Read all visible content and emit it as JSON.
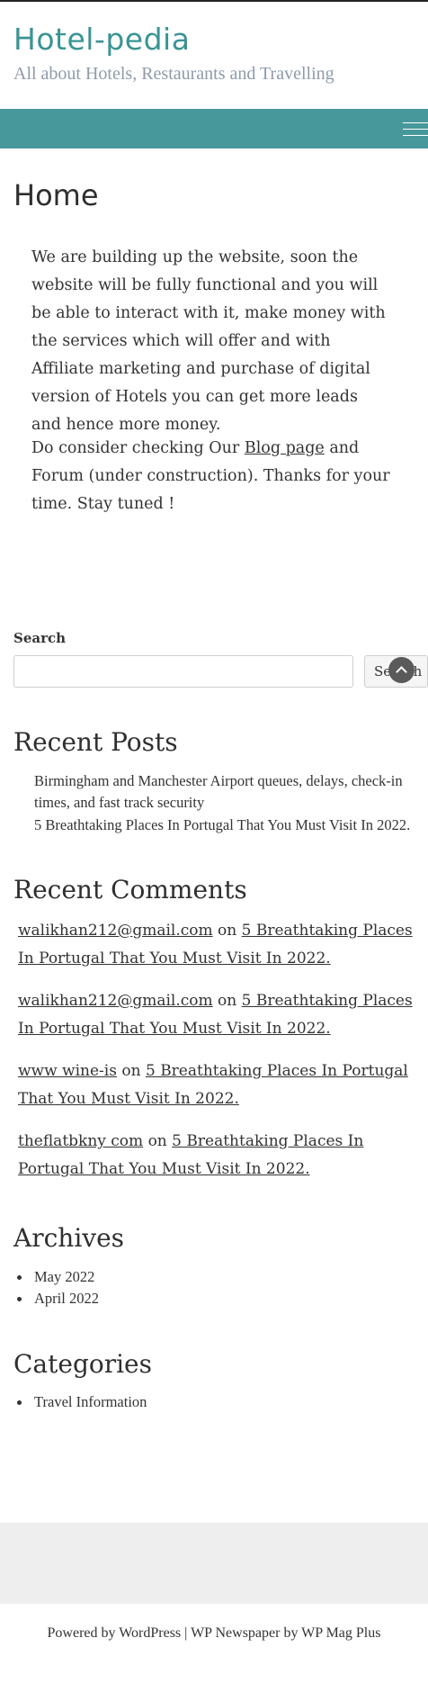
{
  "header": {
    "site_title": "Hotel-pedia",
    "tagline": "All about Hotels, Restaurants and Travelling"
  },
  "nav": {
    "menu_icon": "hamburger-menu-icon"
  },
  "main": {
    "page_title": "Home",
    "paragraph1": "We are building up the website, soon the website will be fully functional and you will be able to interact with it, make money with the services which will offer and with Affiliate marketing and purchase of digital version of Hotels you can get more leads and hence more money.",
    "paragraph2_before": "Do consider checking Our ",
    "paragraph2_link": "Blog page",
    "paragraph2_after": " and Forum (under construction). Thanks for your time. Stay tuned !"
  },
  "search": {
    "label": "Search",
    "value": "",
    "placeholder": "",
    "button_label": "Search"
  },
  "scroll_top_icon": "chevron-up-icon",
  "recent_posts": {
    "title": "Recent Posts",
    "items": [
      "Birmingham and Manchester Airport queues, delays, check-in times, and fast track security",
      "5 Breathtaking Places In Portugal That You Must Visit In 2022."
    ]
  },
  "recent_comments": {
    "title": "Recent Comments",
    "connector": " on ",
    "items": [
      {
        "author": "walikhan212@gmail.com",
        "post": "5 Breathtaking Places In Portugal That You Must Visit In 2022."
      },
      {
        "author": "walikhan212@gmail.com",
        "post": "5 Breathtaking Places In Portugal That You Must Visit In 2022."
      },
      {
        "author": "www wine-is",
        "post": "5 Breathtaking Places In Portugal That You Must Visit In 2022."
      },
      {
        "author": "theflatbkny com",
        "post": "5 Breathtaking Places In Portugal That You Must Visit In 2022."
      }
    ]
  },
  "archives": {
    "title": "Archives",
    "items": [
      "May 2022",
      "April 2022"
    ]
  },
  "categories": {
    "title": "Categories",
    "items": [
      "Travel Information"
    ]
  },
  "footer": {
    "credit": "Powered by WordPress | WP Newspaper by WP Mag Plus"
  },
  "colors": {
    "brand_teal": "#3a9494",
    "nav_bar": "#47989a",
    "tagline": "#8e9bab",
    "footer_band": "#eeeeee"
  }
}
